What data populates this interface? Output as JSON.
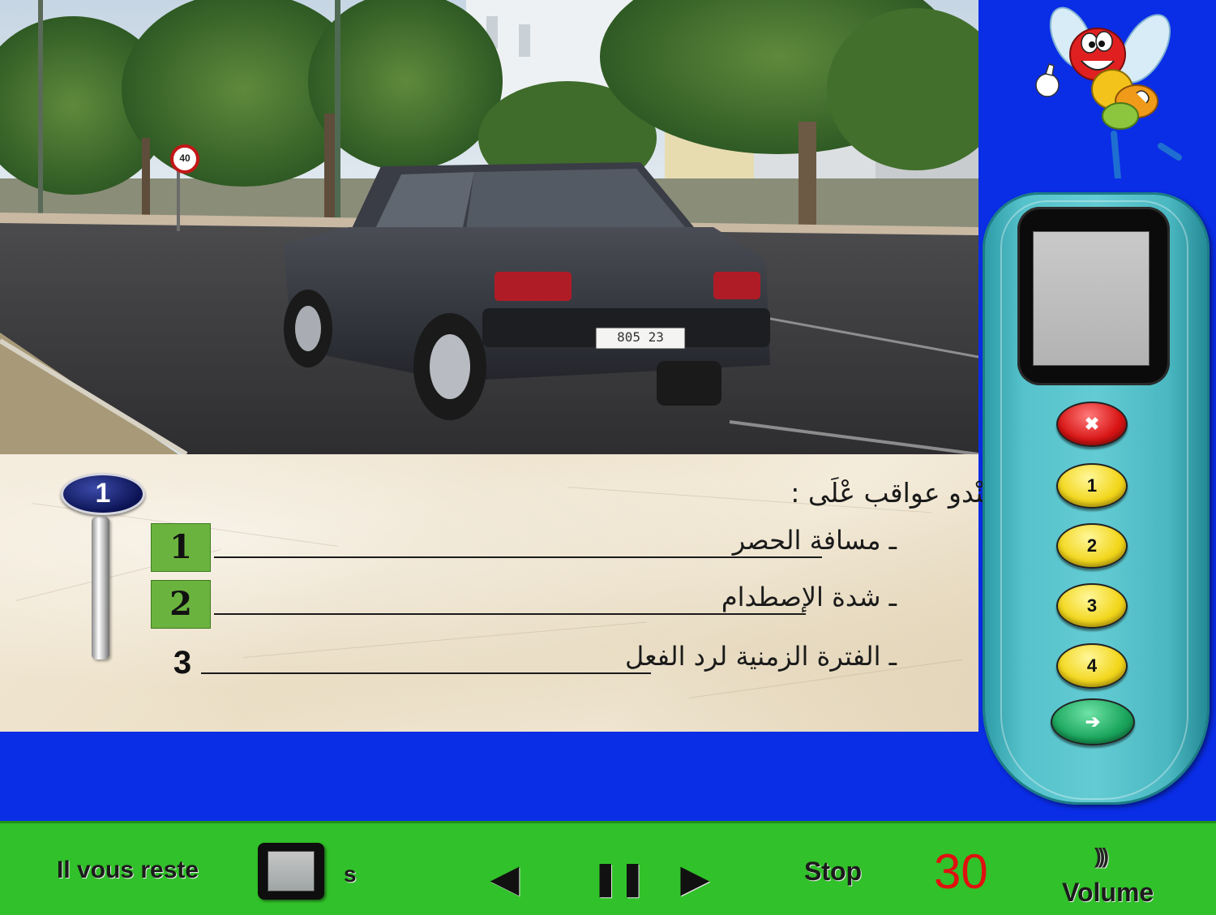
{
  "question": {
    "number": "1",
    "text": "السّير بْسُرْعَة عَنْدو عواقب عْلَى :",
    "answers": [
      {
        "number": "1",
        "label": "ـ مسافة الحصر",
        "selected": true
      },
      {
        "number": "2",
        "label": "ـ شدة الإصطدام",
        "selected": true
      },
      {
        "number": "3",
        "label": "ـ الفترة الزمنية لرد الفعل",
        "selected": false
      }
    ]
  },
  "scene": {
    "speed_sign": "40",
    "plate": "805 23"
  },
  "remote": {
    "buttons": [
      {
        "name": "remote-cancel-button",
        "label": "✖",
        "color": "#d81414"
      },
      {
        "name": "remote-answer-1-button",
        "label": "1",
        "color": "#f2d61a"
      },
      {
        "name": "remote-answer-2-button",
        "label": "2",
        "color": "#f2d61a"
      },
      {
        "name": "remote-answer-3-button",
        "label": "3",
        "color": "#f2d61a"
      },
      {
        "name": "remote-answer-4-button",
        "label": "4",
        "color": "#f2d61a"
      },
      {
        "name": "remote-validate-button",
        "label": "➔",
        "color": "#1aa55c"
      }
    ]
  },
  "bottombar": {
    "remaining_label": "Il vous reste",
    "seconds_unit": "s",
    "prev_icon": "◀",
    "pause_icon": "❚❚",
    "next_icon": "▶",
    "stop_label": "Stop",
    "counter": "30",
    "volume_label": "Volume",
    "volume_icon": ")))"
  },
  "colors": {
    "background_blue": "#0a2de6",
    "bottom_green": "#31c12a",
    "counter_red": "#e01010",
    "remote_teal": "#56c2cb",
    "answer_green": "#6bb33f"
  }
}
